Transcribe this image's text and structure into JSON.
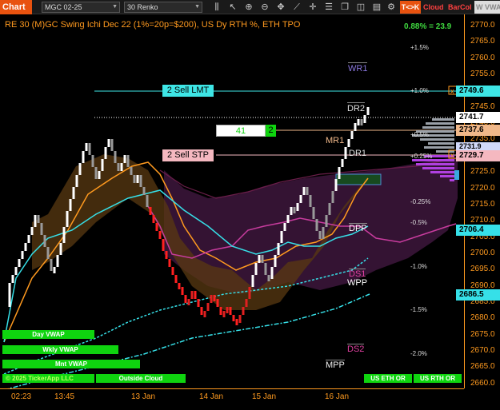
{
  "toolbar": {
    "chart_label": "Chart",
    "instrument": "MGC 02-25",
    "bar_type": "30 Renko",
    "tk_label": "T<>K",
    "cloud_label": "Cloud",
    "barcol_label": "BarCol",
    "vwap_label": "W VWAI"
  },
  "chart": {
    "title": "RE 30 (M)GC Swing Ichi Dec 22 (1%=20p=$200), US Dy RTH %, ETH TPO",
    "performance": "0.88% = 23.9",
    "copyright": "© 2025 TickerApp LLC"
  },
  "y_axis": {
    "ticks": [
      "2770.0",
      "2765.0",
      "2760.0",
      "2755.0",
      "2750.0",
      "2745.0",
      "2740.0",
      "2735.0",
      "2730.0",
      "2725.0",
      "2720.0",
      "2715.0",
      "2710.0",
      "2705.0",
      "2700.0",
      "2695.0",
      "2690.0",
      "2685.0",
      "2680.0",
      "2675.0",
      "2670.0",
      "2665.0",
      "2660.0"
    ]
  },
  "x_axis": {
    "ticks": [
      "02:23",
      "13:45",
      "13 Jan",
      "14 Jan",
      "15 Jan",
      "16 Jan"
    ]
  },
  "price_tags": {
    "lmt": "2749.6",
    "last": "2741.7",
    "bid": "2737.6",
    "stp": "2729.7",
    "hidden": "2731.9",
    "vwap": "2706.4",
    "wvwap": "2686.5"
  },
  "orders": {
    "sell_lmt": "2 Sell LMT",
    "sell_stp": "2 Sell STP",
    "qty": "41",
    "position": "2"
  },
  "levels": {
    "wr1": "WR1",
    "dr2": "DR2",
    "mr1": "MR1",
    "dr1": "DR1",
    "dpp": "DPP",
    "ds1": "DS1",
    "wpp": "WPP",
    "ds2": "DS2",
    "mpp": "MPP"
  },
  "pct_levels": [
    "+1.5%",
    "+1.0%",
    "+0.5%",
    "+0.25%",
    "-0.25%",
    "-0.5%",
    "-1.0%",
    "-1.5%",
    "-2.0%"
  ],
  "buttons": {
    "day_vwap": "Day VWAP",
    "wkly_vwap": "Wkly VWAP",
    "mnt_vwap": "Mnt VWAP",
    "outside_cloud": "Outside Cloud",
    "us_eth": "US ETH OR",
    "us_rth": "US RTH OR"
  },
  "colors": {
    "accent": "#e8520f",
    "axis": "#ff9a1f",
    "lmt": "#3ee6e6",
    "stp": "#f5b8c0",
    "bid": "#f0b88a",
    "vwap": "#36e0e8",
    "button_green": "#0fd40f"
  }
}
